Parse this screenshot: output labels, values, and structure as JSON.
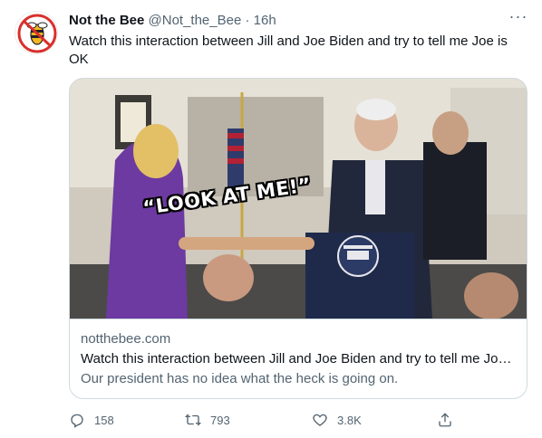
{
  "tweet": {
    "author_name": "Not the Bee",
    "handle": "@Not_the_Bee",
    "separator": "·",
    "time": "16h",
    "more_label": "···",
    "text": "Watch this interaction between Jill and Joe Biden and try to tell me Joe is OK"
  },
  "card": {
    "image_caption": "“LOOK AT ME!”",
    "domain": "notthebee.com",
    "title": "Watch this interaction between Jill and Joe Biden and try to tell me Joe...",
    "description": "Our president has no idea what the heck is going on.",
    "image_icons": [
      "podium-icon",
      "flag-icon"
    ]
  },
  "actions": {
    "reply_count": "158",
    "retweet_count": "793",
    "like_count": "3.8K"
  },
  "colors": {
    "text": "#0f1419",
    "secondary": "#536471",
    "border": "#cfd9de",
    "avatar_red": "#d9302c"
  }
}
